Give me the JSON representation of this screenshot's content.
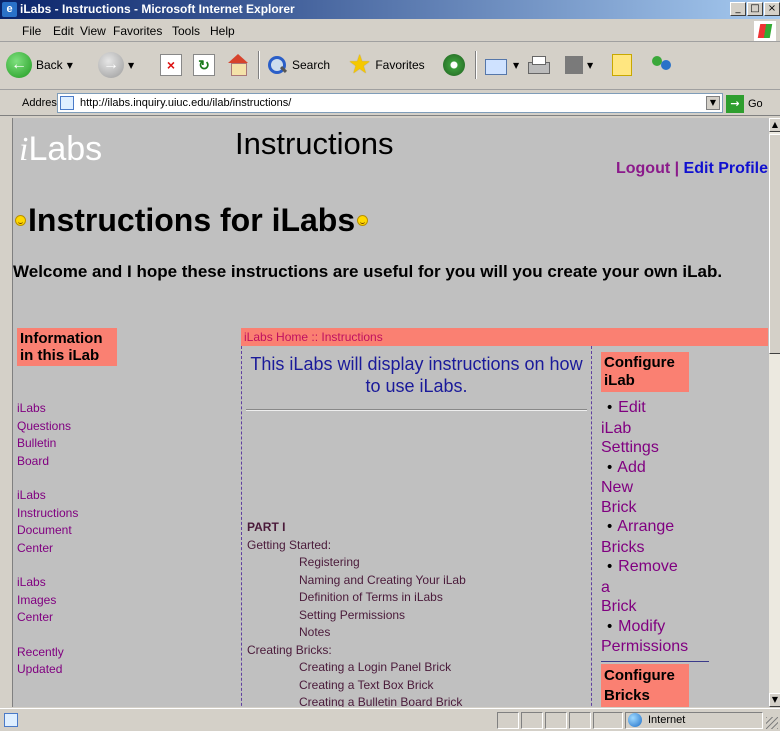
{
  "window": {
    "title": "iLabs - Instructions - Microsoft Internet Explorer",
    "controls": {
      "minimize": "_",
      "maximize": "□",
      "close": "×"
    }
  },
  "menu": [
    "File",
    "Edit",
    "View",
    "Favorites",
    "Tools",
    "Help"
  ],
  "toolbar": {
    "back_label": "Back",
    "search_label": "Search",
    "favorites_label": "Favorites"
  },
  "address": {
    "label": "Address",
    "url": "http://ilabs.inquiry.uiuc.edu/ilab/instructions/",
    "go_label": "Go"
  },
  "page": {
    "logo_i": "i",
    "logo_rest": "Labs",
    "heading": "Instructions",
    "logout": "Logout",
    "separator": " | ",
    "edit_profile": "Edit Profile",
    "main_title": "Instructions for iLabs",
    "welcome": "Welcome and I hope these instructions are useful for you will you create your own iLab.",
    "left_header": "Information in this iLab",
    "left_groups": [
      [
        "iLabs",
        "Questions",
        "Bulletin",
        "Board"
      ],
      [
        "iLabs",
        "Instructions",
        "Document",
        "Center"
      ],
      [
        "iLabs",
        "Images",
        "Center"
      ],
      [
        "Recently",
        "Updated"
      ]
    ],
    "breadcrumb": "iLabs Home :: Instructions",
    "intro": "This iLabs will display instructions on how to use iLabs.",
    "toc": {
      "part": "PART I",
      "sections": [
        {
          "title": "Getting Started:",
          "items": [
            "Registering",
            "Naming and Creating Your iLab",
            "Definition of Terms in iLabs",
            "Setting Permissions",
            "Notes"
          ]
        },
        {
          "title": "Creating Bricks:",
          "items": [
            "Creating a Login Panel Brick",
            "Creating a Text Box Brick",
            "Creating a Bulletin Board Brick"
          ]
        }
      ]
    },
    "right_header": "Configure iLab",
    "right_links": [
      {
        "bullet": "•",
        "words": [
          "Edit",
          "iLab",
          "Settings"
        ]
      },
      {
        "bullet": "•",
        "words": [
          "Add",
          "New",
          "Brick"
        ]
      },
      {
        "bullet": "•",
        "words": [
          "Arrange",
          "Bricks"
        ]
      },
      {
        "bullet": "•",
        "words": [
          "Remove",
          "a",
          "Brick"
        ]
      },
      {
        "bullet": "•",
        "words": [
          "Modify",
          "Permissions"
        ]
      }
    ],
    "right_header2": "Configure Bricks"
  },
  "status": {
    "zone": "Internet"
  },
  "colors": {
    "salmon": "#fa8072",
    "link_purple": "#800080",
    "edit_blue": "#1010d0",
    "page_gray": "#c0c0c0"
  }
}
